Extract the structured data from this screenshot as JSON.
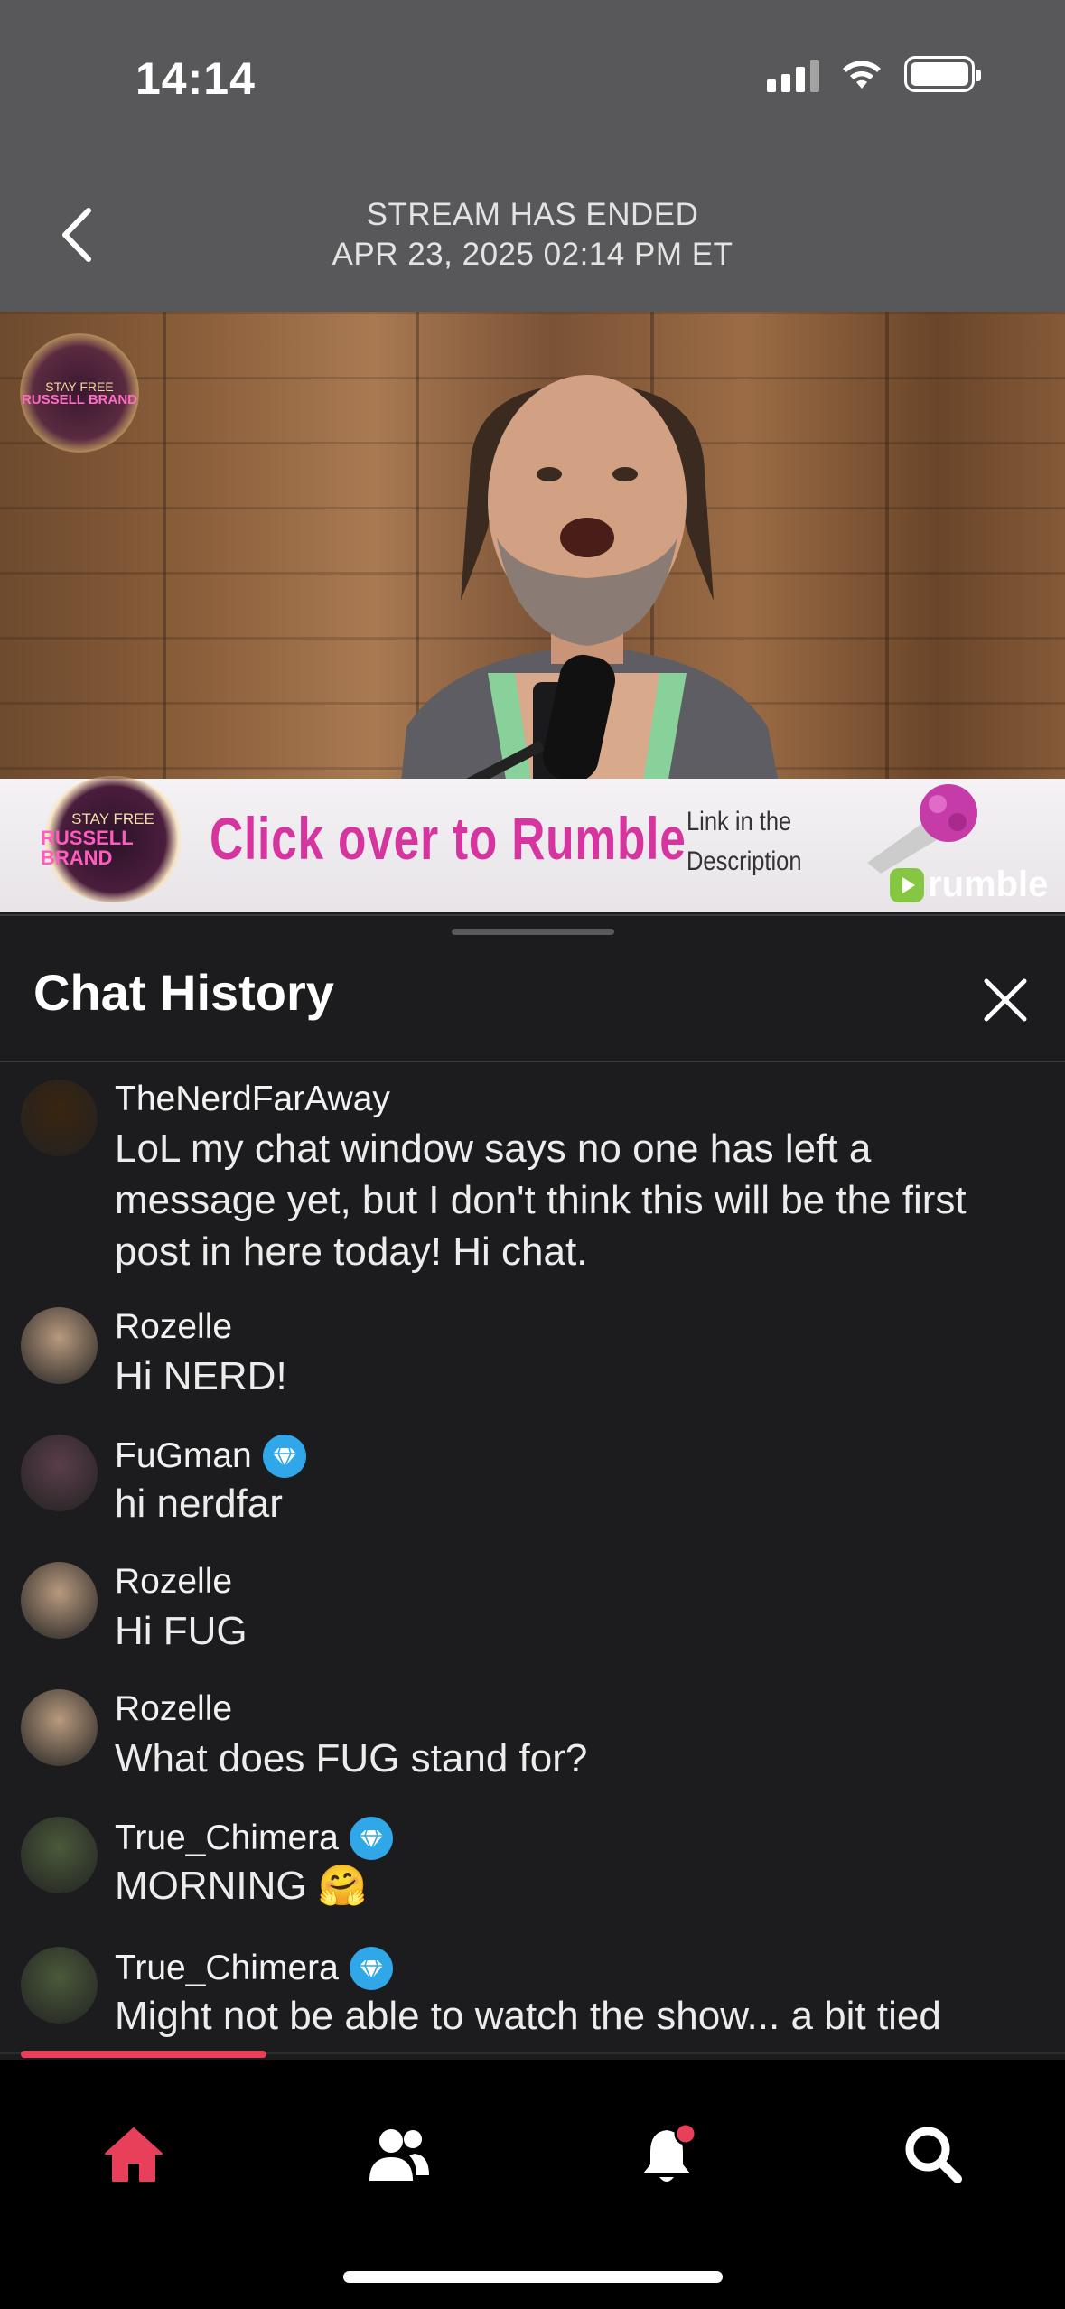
{
  "status_bar": {
    "time": "14:14"
  },
  "header": {
    "line1": "STREAM HAS ENDED",
    "line2": "APR 23, 2025 02:14 PM ET"
  },
  "video": {
    "corner_logo_top": "STAY FREE",
    "corner_logo_bottom": "RUSSELL BRAND",
    "banner_logo_top": "STAY FREE",
    "banner_logo_bottom": "RUSSELL BRAND",
    "banner_text": "Click over to Rumble",
    "banner_sub1": "Link in the",
    "banner_sub2": "Description",
    "watermark": "rumble"
  },
  "chat": {
    "title": "Chat History",
    "messages": [
      {
        "user": "TheNerdFarAway",
        "badge": false,
        "text": "LoL my chat window says no one has left a message yet, but I don't think this will be the first post in here today! Hi chat.",
        "avatar_color": "#3a2410"
      },
      {
        "user": "Rozelle",
        "badge": false,
        "text": "Hi NERD!",
        "avatar_color": "#b89a7e"
      },
      {
        "user": "FuGman",
        "badge": true,
        "text": "hi nerdfar",
        "avatar_color": "#5a3e4a"
      },
      {
        "user": "Rozelle",
        "badge": false,
        "text": "Hi FUG",
        "avatar_color": "#b89a7e"
      },
      {
        "user": "Rozelle",
        "badge": false,
        "text": "What does FUG stand for?",
        "avatar_color": "#b89a7e"
      },
      {
        "user": "True_Chimera",
        "badge": true,
        "text": "MORNING 🤗",
        "avatar_color": "#4a5a3a"
      },
      {
        "user": "True_Chimera",
        "badge": true,
        "text": "Might not be able to watch the show... a bit tied",
        "avatar_color": "#4a5a3a"
      }
    ]
  },
  "tabbar": {
    "items": [
      "home-icon",
      "people-icon",
      "bell-icon",
      "search-icon"
    ],
    "active_color": "#e8405a"
  }
}
